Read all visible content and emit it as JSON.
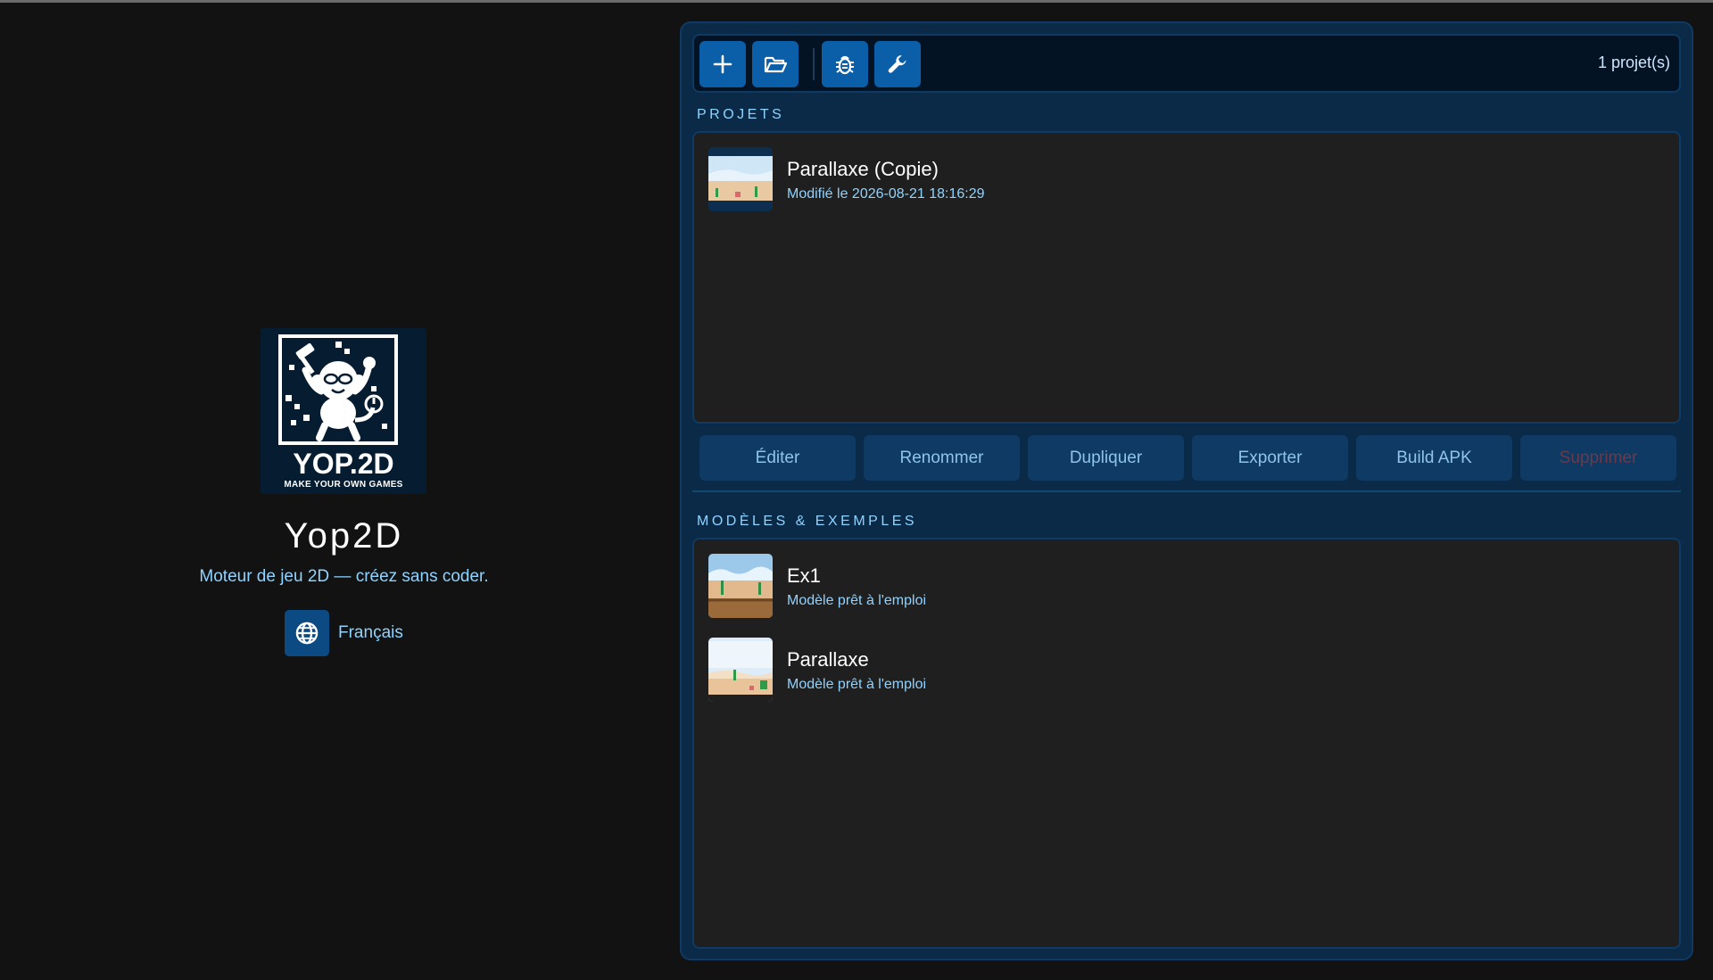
{
  "app": {
    "name": "Yop2D",
    "tagline": "Moteur de jeu 2D — créez sans coder.",
    "language": "Français",
    "logo": {
      "title": "YOP.2D",
      "subtitle": "MAKE YOUR OWN GAMES"
    }
  },
  "toolbar": {
    "buttons": [
      {
        "icon": "plus-icon"
      },
      {
        "icon": "folder-open-icon"
      },
      {
        "icon": "bug-icon"
      },
      {
        "icon": "wrench-icon"
      }
    ],
    "count_label": "1 projet(s)"
  },
  "projects": {
    "section_label": "PROJETS",
    "items": [
      {
        "title": "Parallaxe (Copie)",
        "subtitle": "Modifié le 2026-08-21 18:16:29"
      }
    ]
  },
  "actions": {
    "edit": "Éditer",
    "rename": "Renommer",
    "duplicate": "Dupliquer",
    "export": "Exporter",
    "build_apk": "Build APK",
    "delete": "Supprimer"
  },
  "templates": {
    "section_label": "MODÈLES & EXEMPLES",
    "items": [
      {
        "title": "Ex1",
        "subtitle": "Modèle prêt à l'emploi"
      },
      {
        "title": "Parallaxe",
        "subtitle": "Modèle prêt à l'emploi"
      }
    ]
  },
  "colors": {
    "background": "#121212",
    "panel": "#0a2a47",
    "accent_button": "#0b5ea8",
    "secondary_text": "#8fd3ff",
    "list_background": "#1f1f1f",
    "delete_disabled_text": "#6a3a4c"
  }
}
